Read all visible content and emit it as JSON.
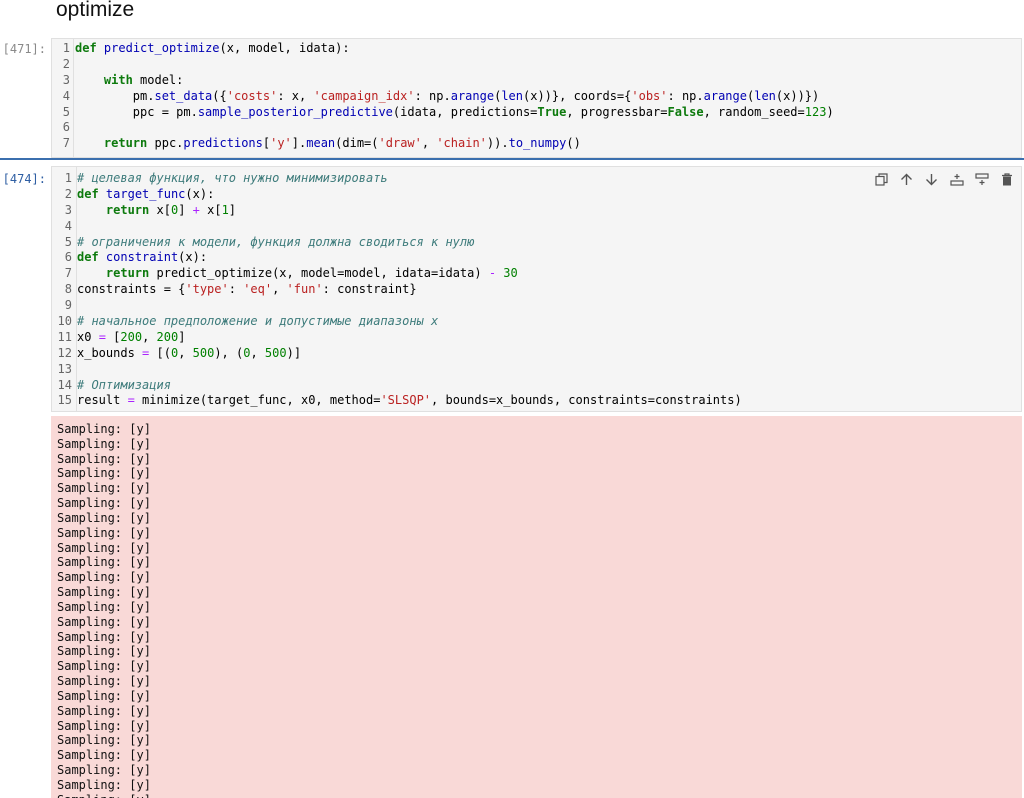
{
  "heading": "optimize",
  "cells": [
    {
      "prompt": "[471]:",
      "lines": [
        "1",
        "2",
        "3",
        "4",
        "5",
        "6",
        "7"
      ]
    },
    {
      "prompt": "[474]:",
      "lines": [
        "1",
        "2",
        "3",
        "4",
        "5",
        "6",
        "7",
        "8",
        "9",
        "10",
        "11",
        "12",
        "13",
        "14",
        "15"
      ]
    }
  ],
  "toolbar": {
    "icons": [
      "copy-icon",
      "move-up-icon",
      "move-down-icon",
      "insert-above-icon",
      "insert-below-icon",
      "delete-icon"
    ]
  },
  "output": {
    "line_text": "Sampling: [y]",
    "visible_lines": 26
  }
}
